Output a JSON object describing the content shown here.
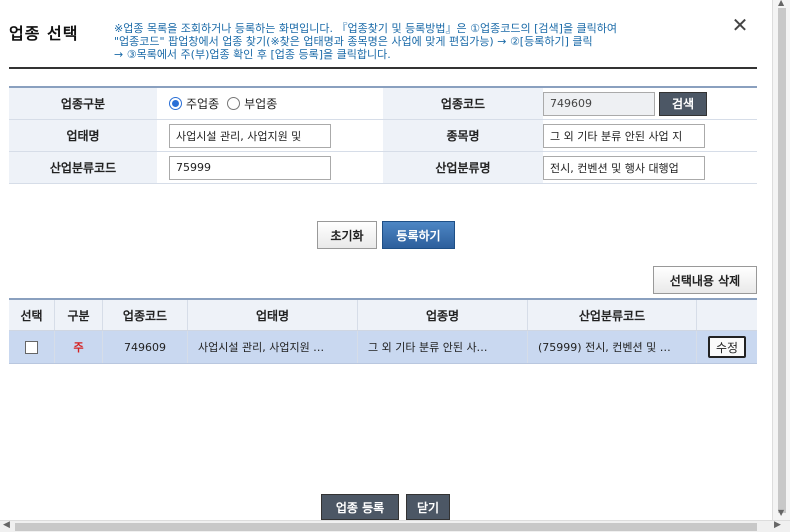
{
  "dialog": {
    "title": "업종 선택",
    "notice": "※업종 목록을 조회하거나 등록하는 화면입니다. 『업종찾기 및 등록방법』은 ①업종코드의 [검색]을 클릭하여\n\"업종코드\" 팝업창에서 업종 찾기(※찾은 업태명과 종목명은 사업에 맞게 편집가능) → ②[등록하기] 클릭\n→ ③목록에서 주(부)업종 확인 후 [업종 등록]을 클릭합니다.",
    "close": "✕"
  },
  "form": {
    "type_label": "업종구분",
    "type_options": [
      "주업종",
      "부업종"
    ],
    "type_selected": "주업종",
    "code_label": "업종코드",
    "code_value": "749609",
    "search_button": "검색",
    "business_label": "업태명",
    "business_value": "사업시설 관리, 사업지원 및",
    "item_label": "종목명",
    "item_value": "그 외 기타 분류 안된 사업 지",
    "industry_code_label": "산업분류코드",
    "industry_code_value": "75999",
    "industry_name_label": "산업분류명",
    "industry_name_value": "전시, 컨벤션 및 행사 대행업"
  },
  "actions": {
    "reset": "초기화",
    "register": "등록하기",
    "delete_selected": "선택내용 삭제",
    "submit": "업종 등록",
    "close": "닫기"
  },
  "table": {
    "headers": [
      "선택",
      "구분",
      "업종코드",
      "업태명",
      "업종명",
      "산업분류코드",
      ""
    ],
    "rows": [
      {
        "gubun": "주",
        "code": "749609",
        "business": "사업시설 관리, 사업지원 …",
        "name": "그 외 기타 분류 안된 사…",
        "industry": "(75999) 전시, 컨벤션 및 …",
        "edit": "수정"
      }
    ]
  }
}
